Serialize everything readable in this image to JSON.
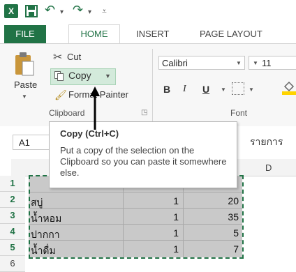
{
  "qat": {
    "logo_text": "X",
    "icons": [
      "excel-logo-icon",
      "save-icon",
      "undo-icon",
      "redo-icon",
      "customize-qat-icon"
    ]
  },
  "tabs": {
    "file": "FILE",
    "home": "HOME",
    "insert": "INSERT",
    "page_layout": "PAGE LAYOUT"
  },
  "clipboard": {
    "paste": "Paste",
    "cut": "Cut",
    "copy": "Copy",
    "format_painter": "Format Painter",
    "group_label": "Clipboard"
  },
  "font": {
    "name": "Calibri",
    "size": "11",
    "bold": "B",
    "italic": "I",
    "underline": "U",
    "group_label": "Font"
  },
  "formula_bar": {
    "name_box": "A1",
    "content": "รายการ"
  },
  "grid": {
    "col_d": "D",
    "row_headers": [
      "1",
      "2",
      "3",
      "4",
      "5",
      "6"
    ],
    "rows": [
      {
        "a": "สบู่",
        "b": "1",
        "c": "20"
      },
      {
        "a": "น้ำหอม",
        "b": "1",
        "c": "35"
      },
      {
        "a": "ปากกา",
        "b": "1",
        "c": "5"
      },
      {
        "a": "น้ำดื่ม",
        "b": "1",
        "c": "7"
      }
    ]
  },
  "tooltip": {
    "title": "Copy (Ctrl+C)",
    "body": "Put a copy of the selection on the Clipboard so you can paste it somewhere else."
  },
  "colors": {
    "accent": "#217346",
    "hover": "#d3eadb",
    "selection": "#c9c9c9"
  }
}
